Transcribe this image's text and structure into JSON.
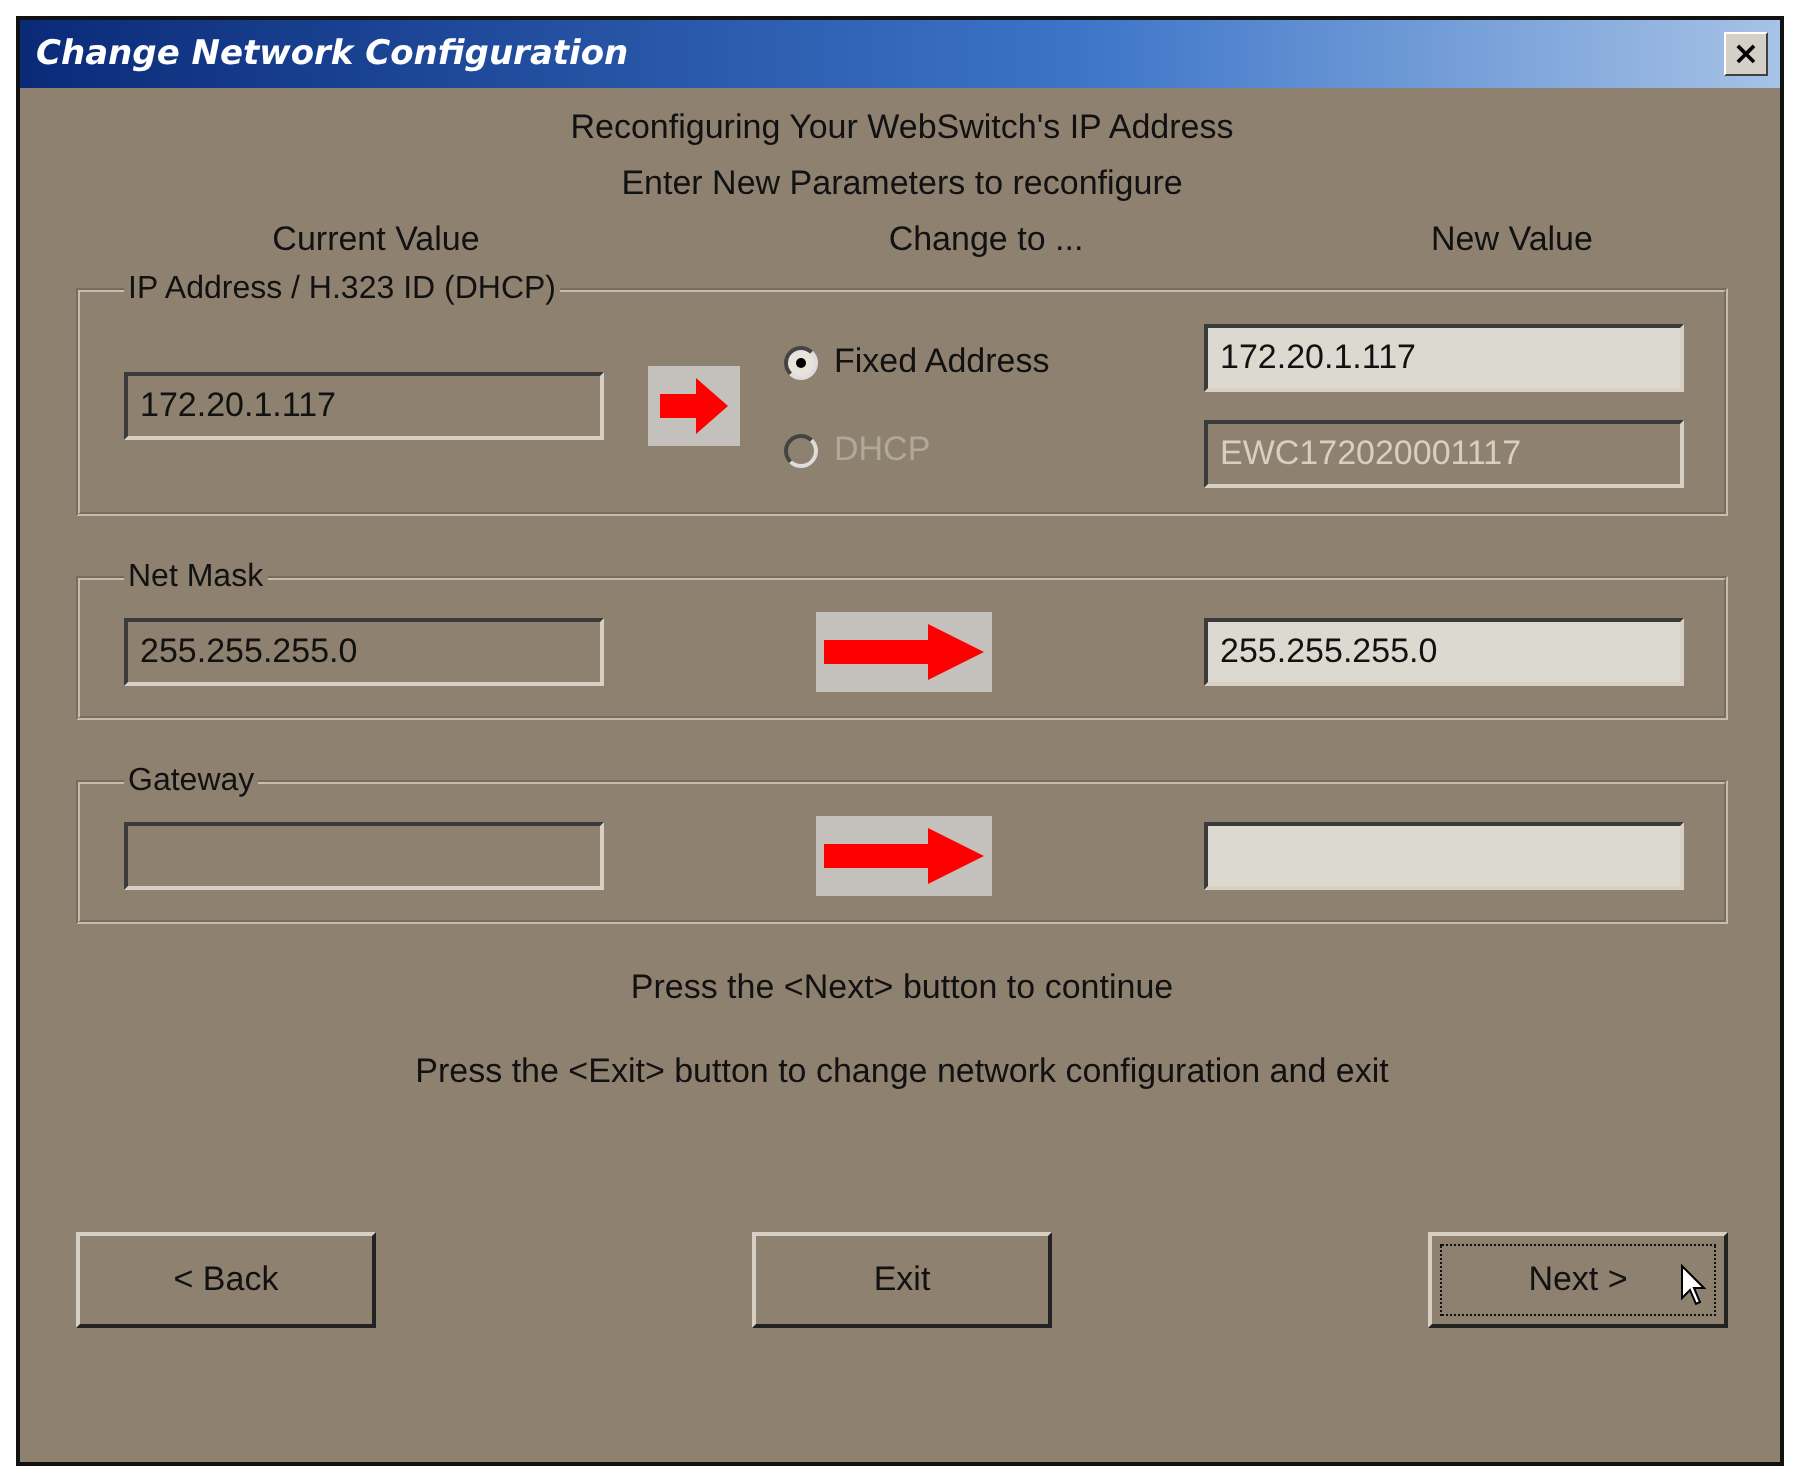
{
  "window": {
    "title": "Change Network Configuration",
    "close": "×"
  },
  "headings": [
    "Reconfiguring Your WebSwitch's IP Address",
    "Enter New Parameters to reconfigure"
  ],
  "columns": [
    "Current Value",
    "Change to ...",
    "New Value"
  ],
  "groups": [
    {
      "kind": "choice",
      "label": "IP Address / H.323 ID (DHCP)",
      "current": "172.20.1.117",
      "options": [
        {
          "label": "Fixed Address",
          "selected": true,
          "disabled": false,
          "value": "172.20.1.117"
        },
        {
          "label": "DHCP",
          "selected": false,
          "disabled": true,
          "value": "EWC172020001117"
        }
      ]
    },
    {
      "kind": "plain",
      "label": "Net Mask",
      "current": "255.255.255.0",
      "value": "255.255.255.0"
    },
    {
      "kind": "plain",
      "label": "Gateway"
    }
  ],
  "notes": [
    "Press the <Next> button to continue",
    "Press the <Exit> button to change network configuration and exit"
  ],
  "buttons": [
    {
      "label": "< Back",
      "focused": false
    },
    {
      "label": "Exit",
      "focused": false
    },
    {
      "label": "Next >",
      "focused": true
    }
  ]
}
